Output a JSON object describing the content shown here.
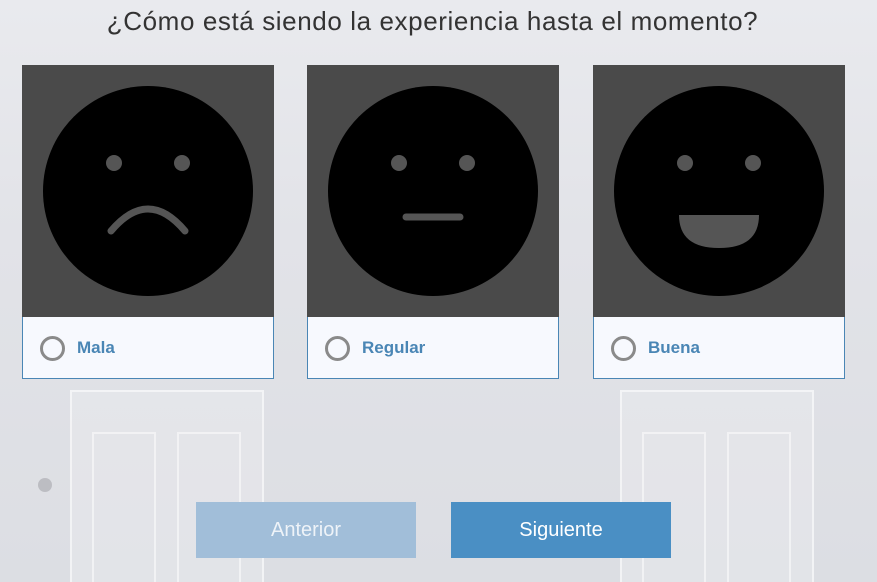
{
  "question": "¿Cómo está siendo la experiencia hasta el momento?",
  "options": [
    {
      "label": "Mala",
      "face": "sad-face-icon",
      "selected": false
    },
    {
      "label": "Regular",
      "face": "neutral-face-icon",
      "selected": false
    },
    {
      "label": "Buena",
      "face": "happy-face-icon",
      "selected": false
    }
  ],
  "buttons": {
    "previous": "Anterior",
    "next": "Siguiente"
  },
  "colors": {
    "accent": "#4a86b5",
    "next_button": "#4a8fc4",
    "previous_button": "#a1bed9",
    "image_background": "#4a4a4a",
    "face": "#000000",
    "face_features": "#555555"
  }
}
